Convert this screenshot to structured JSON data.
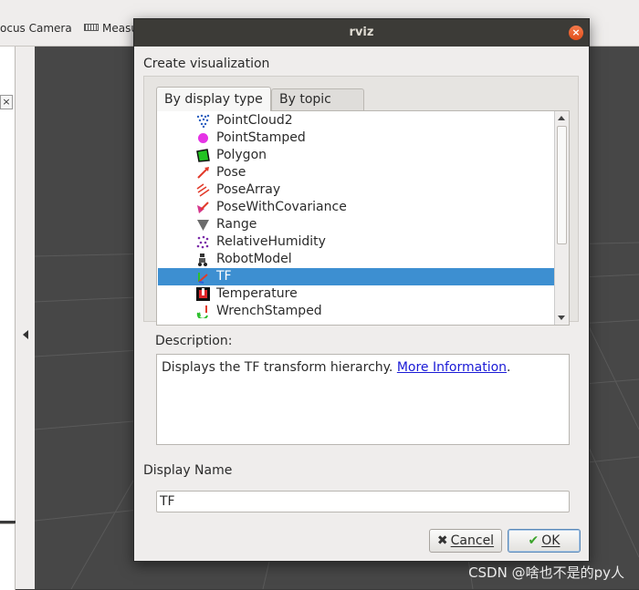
{
  "background": {
    "toolbar": {
      "focus_camera": "ocus Camera",
      "measure": "Measu"
    },
    "close_box": "×"
  },
  "dialog": {
    "title": "rviz",
    "close_glyph": "×",
    "create_label": "Create visualization",
    "tabs": [
      {
        "label": "By display type",
        "active": true
      },
      {
        "label": "By topic",
        "active": false
      }
    ],
    "items": [
      {
        "label": "PointCloud2",
        "icon": "pointcloud2-icon"
      },
      {
        "label": "PointStamped",
        "icon": "pointstamped-icon"
      },
      {
        "label": "Polygon",
        "icon": "polygon-icon"
      },
      {
        "label": "Pose",
        "icon": "pose-icon"
      },
      {
        "label": "PoseArray",
        "icon": "posearray-icon"
      },
      {
        "label": "PoseWithCovariance",
        "icon": "posewithcovariance-icon"
      },
      {
        "label": "Range",
        "icon": "range-icon"
      },
      {
        "label": "RelativeHumidity",
        "icon": "relativehumidity-icon"
      },
      {
        "label": "RobotModel",
        "icon": "robotmodel-icon"
      },
      {
        "label": "TF",
        "icon": "tf-icon",
        "selected": true
      },
      {
        "label": "Temperature",
        "icon": "temperature-icon"
      },
      {
        "label": "WrenchStamped",
        "icon": "wrenchstamped-icon"
      }
    ],
    "description_label": "Description:",
    "description_text": "Displays the TF transform hierarchy. ",
    "description_link": "More Information",
    "description_end": ".",
    "display_name_label": "Display Name",
    "display_name_value": "TF",
    "cancel_label": "Cancel",
    "ok_label": "OK"
  },
  "watermark": "CSDN @啥也不是的py人"
}
